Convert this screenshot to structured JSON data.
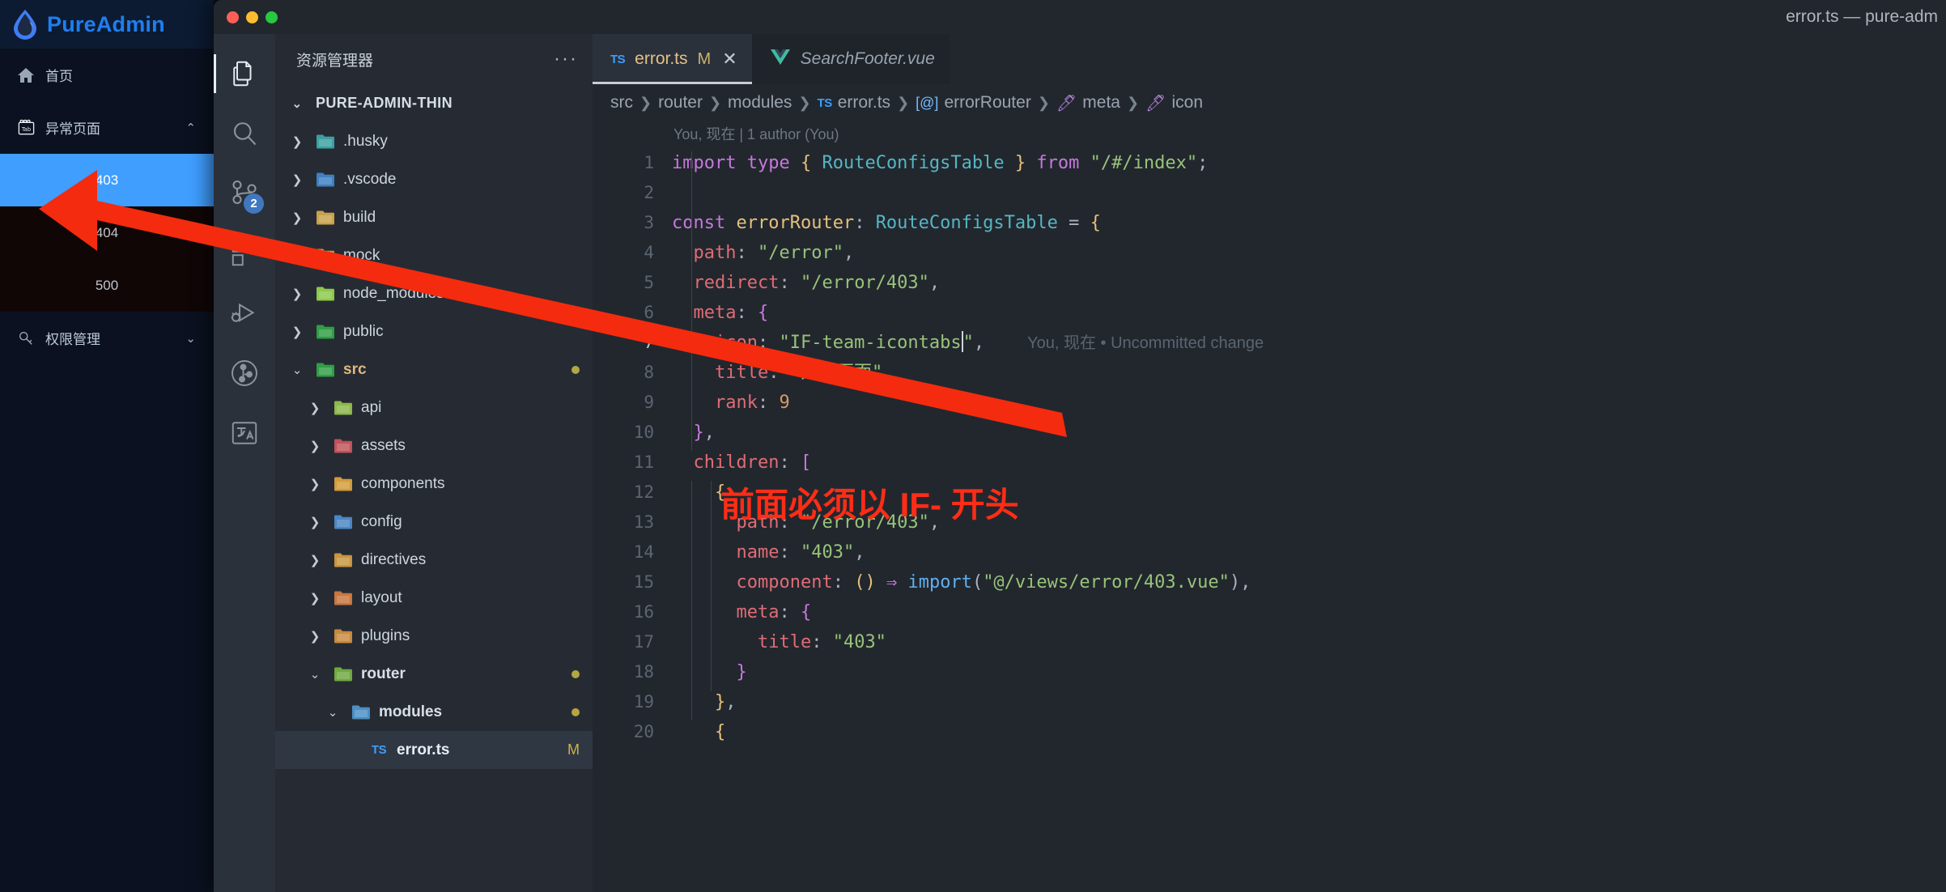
{
  "pure_admin": {
    "brand": "PureAdmin",
    "logo_icon": "water-drop-icon",
    "nav": [
      {
        "label": "首页",
        "icon": "home-icon",
        "caret": ""
      },
      {
        "label": "异常页面",
        "icon": "tab-icon",
        "caret": "⌃"
      }
    ],
    "submenu": [
      {
        "label": "403",
        "active": true
      },
      {
        "label": "404",
        "active": false
      },
      {
        "label": "500",
        "active": false
      }
    ],
    "nav2": {
      "label": "权限管理",
      "icon": "key-icon",
      "caret": "⌄"
    }
  },
  "window": {
    "title": "error.ts — pure-adm",
    "traffic": [
      "close",
      "minimize",
      "zoom"
    ]
  },
  "activity_bar": {
    "items": [
      {
        "name": "explorer-icon",
        "active": true,
        "badge": ""
      },
      {
        "name": "search-icon",
        "active": false,
        "badge": ""
      },
      {
        "name": "source-control-icon",
        "active": false,
        "badge": "2"
      },
      {
        "name": "extensions-icon",
        "active": false,
        "badge": ""
      },
      {
        "name": "run-and-debug-icon",
        "active": false,
        "badge": ""
      },
      {
        "name": "testing-icon",
        "active": false,
        "badge": ""
      },
      {
        "name": "translate-icon",
        "active": false,
        "badge": ""
      }
    ]
  },
  "explorer": {
    "title": "资源管理器",
    "more_label": "···",
    "root": "PURE-ADMIN-THIN",
    "tree": [
      {
        "label": ".husky",
        "twisty": "›",
        "icon": "folder-husky",
        "indent": 0,
        "badge": ""
      },
      {
        "label": ".vscode",
        "twisty": "›",
        "icon": "folder-vscode",
        "indent": 0,
        "badge": ""
      },
      {
        "label": "build",
        "twisty": "›",
        "icon": "folder-build",
        "indent": 0,
        "badge": ""
      },
      {
        "label": "mock",
        "twisty": "›",
        "icon": "folder-plain",
        "indent": 0,
        "badge": ""
      },
      {
        "label": "node_modules",
        "twisty": "›",
        "icon": "folder-node",
        "indent": 0,
        "badge": ""
      },
      {
        "label": "public",
        "twisty": "›",
        "icon": "folder-public",
        "indent": 0,
        "badge": ""
      },
      {
        "label": "src",
        "twisty": "⌄",
        "icon": "folder-src",
        "indent": 0,
        "badge": "dot"
      },
      {
        "label": "api",
        "twisty": "›",
        "icon": "folder-api",
        "indent": 1,
        "badge": ""
      },
      {
        "label": "assets",
        "twisty": "›",
        "icon": "folder-assets",
        "indent": 1,
        "badge": ""
      },
      {
        "label": "components",
        "twisty": "›",
        "icon": "folder-components",
        "indent": 1,
        "badge": ""
      },
      {
        "label": "config",
        "twisty": "›",
        "icon": "folder-config",
        "indent": 1,
        "badge": ""
      },
      {
        "label": "directives",
        "twisty": "›",
        "icon": "folder-plain",
        "indent": 1,
        "badge": ""
      },
      {
        "label": "layout",
        "twisty": "›",
        "icon": "folder-layout",
        "indent": 1,
        "badge": ""
      },
      {
        "label": "plugins",
        "twisty": "›",
        "icon": "folder-plugins",
        "indent": 1,
        "badge": ""
      },
      {
        "label": "router",
        "twisty": "⌄",
        "icon": "folder-router",
        "indent": 1,
        "badge": "dot"
      },
      {
        "label": "modules",
        "twisty": "⌄",
        "icon": "folder-modules",
        "indent": 2,
        "badge": "dot"
      },
      {
        "label": "error.ts",
        "twisty": "",
        "icon": "ts-file",
        "indent": 3,
        "badge": "M"
      }
    ]
  },
  "tabs": [
    {
      "label": "error.ts",
      "icon": "ts-icon",
      "modified": "M",
      "close": "✕",
      "active": true,
      "preview": false
    },
    {
      "label": "SearchFooter.vue",
      "icon": "vue-icon",
      "modified": "",
      "close": "",
      "active": false,
      "preview": true
    }
  ],
  "breadcrumb": [
    {
      "label": "src",
      "icon": ""
    },
    {
      "label": "router",
      "icon": ""
    },
    {
      "label": "modules",
      "icon": ""
    },
    {
      "label": "error.ts",
      "icon": "ts-icon"
    },
    {
      "label": "errorRouter",
      "icon": "variable-icon"
    },
    {
      "label": "meta",
      "icon": "property-icon"
    },
    {
      "label": "icon",
      "icon": "property-icon"
    }
  ],
  "editor": {
    "blame": "You, 现在 | 1 author (You)",
    "inline_hint": "You, 现在 • Uncommitted change",
    "line_numbers": [
      "1",
      "2",
      "3",
      "4",
      "5",
      "6",
      "7",
      "8",
      "9",
      "10",
      "11",
      "12",
      "13",
      "14",
      "15",
      "16",
      "17",
      "18",
      "19",
      "20"
    ],
    "current_line": "7",
    "lines": [
      "import type { RouteConfigsTable } from \"/#/index\";",
      "",
      "const errorRouter: RouteConfigsTable = {",
      "  path: \"/error\",",
      "  redirect: \"/error/403\",",
      "  meta: {",
      "    icon: \"IF-team-icontabs\",",
      "    title: \"异常页面\",",
      "    rank: 9",
      "  },",
      "  children: [",
      "    {",
      "      path: \"/error/403\",",
      "      name: \"403\",",
      "      component: () => import(\"@/views/error/403.vue\"),",
      "      meta: {",
      "        title: \"403\"",
      "      }",
      "    },",
      "    {"
    ]
  },
  "annotations": {
    "note_text": "前面必须以 IF- 开头",
    "note_color": "#ff2d16",
    "arrow_color": "#ff2d16",
    "arrow_from": "code-line-7",
    "arrow_to": "sidebar-item-exception-pages"
  }
}
